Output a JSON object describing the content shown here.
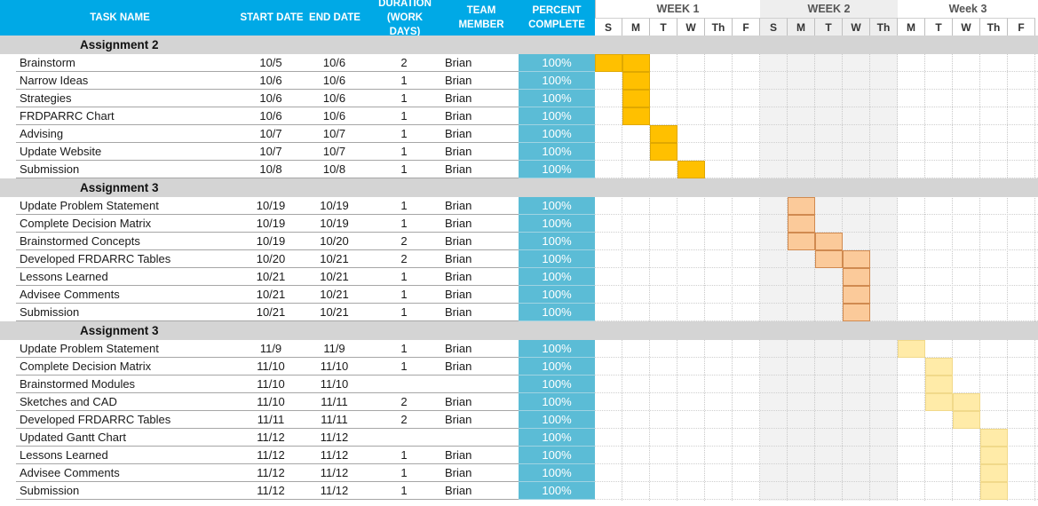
{
  "headers": {
    "task_name": "TASK NAME",
    "start_date": "START DATE",
    "end_date": "END DATE",
    "duration": "DURATION (WORK DAYS)",
    "team_member": "TEAM MEMBER",
    "percent_complete": "PERCENT COMPLETE"
  },
  "weeks": [
    "WEEK 1",
    "WEEK 2",
    "Week 3"
  ],
  "days": [
    "S",
    "M",
    "T",
    "W",
    "Th",
    "F",
    "S",
    "M",
    "T",
    "W",
    "Th",
    "M",
    "T",
    "W",
    "Th",
    "F"
  ],
  "colors": {
    "header_bg": "#00a9e6",
    "percent_bg": "#5bbcd6",
    "group_bg": "#d4d4d4",
    "bar_group1": "#ffc000",
    "bar_group2": "#fbca9a",
    "bar_group3": "#ffeba8"
  },
  "groups": [
    {
      "title": "Assignment 2",
      "tasks": [
        {
          "name": "Brainstorm",
          "start": "10/5",
          "end": "10/6",
          "duration": "2",
          "member": "Brian",
          "percent": "100%",
          "bar_days": [
            0,
            1
          ]
        },
        {
          "name": "Narrow Ideas",
          "start": "10/6",
          "end": "10/6",
          "duration": "1",
          "member": "Brian",
          "percent": "100%",
          "bar_days": [
            1
          ]
        },
        {
          "name": "Strategies",
          "start": "10/6",
          "end": "10/6",
          "duration": "1",
          "member": "Brian",
          "percent": "100%",
          "bar_days": [
            1
          ]
        },
        {
          "name": "FRDPARRC Chart",
          "start": "10/6",
          "end": "10/6",
          "duration": "1",
          "member": "Brian",
          "percent": "100%",
          "bar_days": [
            1
          ]
        },
        {
          "name": "Advising",
          "start": "10/7",
          "end": "10/7",
          "duration": "1",
          "member": "Brian",
          "percent": "100%",
          "bar_days": [
            2
          ]
        },
        {
          "name": "Update Website",
          "start": "10/7",
          "end": "10/7",
          "duration": "1",
          "member": "Brian",
          "percent": "100%",
          "bar_days": [
            2
          ]
        },
        {
          "name": "Submission",
          "start": "10/8",
          "end": "10/8",
          "duration": "1",
          "member": "Brian",
          "percent": "100%",
          "bar_days": [
            3
          ]
        }
      ]
    },
    {
      "title": "Assignment 3",
      "tasks": [
        {
          "name": "Update Problem Statement",
          "start": "10/19",
          "end": "10/19",
          "duration": "1",
          "member": "Brian",
          "percent": "100%",
          "bar_days": [
            7
          ]
        },
        {
          "name": "Complete Decision Matrix",
          "start": "10/19",
          "end": "10/19",
          "duration": "1",
          "member": "Brian",
          "percent": "100%",
          "bar_days": [
            7
          ]
        },
        {
          "name": "Brainstormed Concepts",
          "start": "10/19",
          "end": "10/20",
          "duration": "2",
          "member": "Brian",
          "percent": "100%",
          "bar_days": [
            7,
            8
          ]
        },
        {
          "name": "Developed FRDARRC Tables",
          "start": "10/20",
          "end": "10/21",
          "duration": "2",
          "member": "Brian",
          "percent": "100%",
          "bar_days": [
            8,
            9
          ]
        },
        {
          "name": "Lessons Learned",
          "start": "10/21",
          "end": "10/21",
          "duration": "1",
          "member": "Brian",
          "percent": "100%",
          "bar_days": [
            9
          ]
        },
        {
          "name": "Advisee Comments",
          "start": "10/21",
          "end": "10/21",
          "duration": "1",
          "member": "Brian",
          "percent": "100%",
          "bar_days": [
            9
          ]
        },
        {
          "name": "Submission",
          "start": "10/21",
          "end": "10/21",
          "duration": "1",
          "member": "Brian",
          "percent": "100%",
          "bar_days": [
            9
          ]
        }
      ]
    },
    {
      "title": "Assignment 3",
      "tasks": [
        {
          "name": "Update Problem Statement",
          "start": "11/9",
          "end": "11/9",
          "duration": "1",
          "member": "Brian",
          "percent": "100%",
          "bar_days": [
            11
          ]
        },
        {
          "name": "Complete Decision Matrix",
          "start": "11/10",
          "end": "11/10",
          "duration": "1",
          "member": "Brian",
          "percent": "100%",
          "bar_days": [
            12
          ]
        },
        {
          "name": "Brainstormed Modules",
          "start": "11/10",
          "end": "11/10",
          "duration": "",
          "member": "",
          "percent": "100%",
          "bar_days": [
            12
          ]
        },
        {
          "name": "Sketches and CAD",
          "start": "11/10",
          "end": "11/11",
          "duration": "2",
          "member": "Brian",
          "percent": "100%",
          "bar_days": [
            12,
            13
          ]
        },
        {
          "name": "Developed FRDARRC Tables",
          "start": "11/11",
          "end": "11/11",
          "duration": "2",
          "member": "Brian",
          "percent": "100%",
          "bar_days": [
            13
          ]
        },
        {
          "name": "Updated Gantt Chart",
          "start": "11/12",
          "end": "11/12",
          "duration": "",
          "member": "",
          "percent": "100%",
          "bar_days": [
            14
          ]
        },
        {
          "name": "Lessons Learned",
          "start": "11/12",
          "end": "11/12",
          "duration": "1",
          "member": "Brian",
          "percent": "100%",
          "bar_days": [
            14
          ]
        },
        {
          "name": "Advisee Comments",
          "start": "11/12",
          "end": "11/12",
          "duration": "1",
          "member": "Brian",
          "percent": "100%",
          "bar_days": [
            14
          ]
        },
        {
          "name": "Submission",
          "start": "11/12",
          "end": "11/12",
          "duration": "1",
          "member": "Brian",
          "percent": "100%",
          "bar_days": [
            14
          ]
        }
      ]
    }
  ]
}
